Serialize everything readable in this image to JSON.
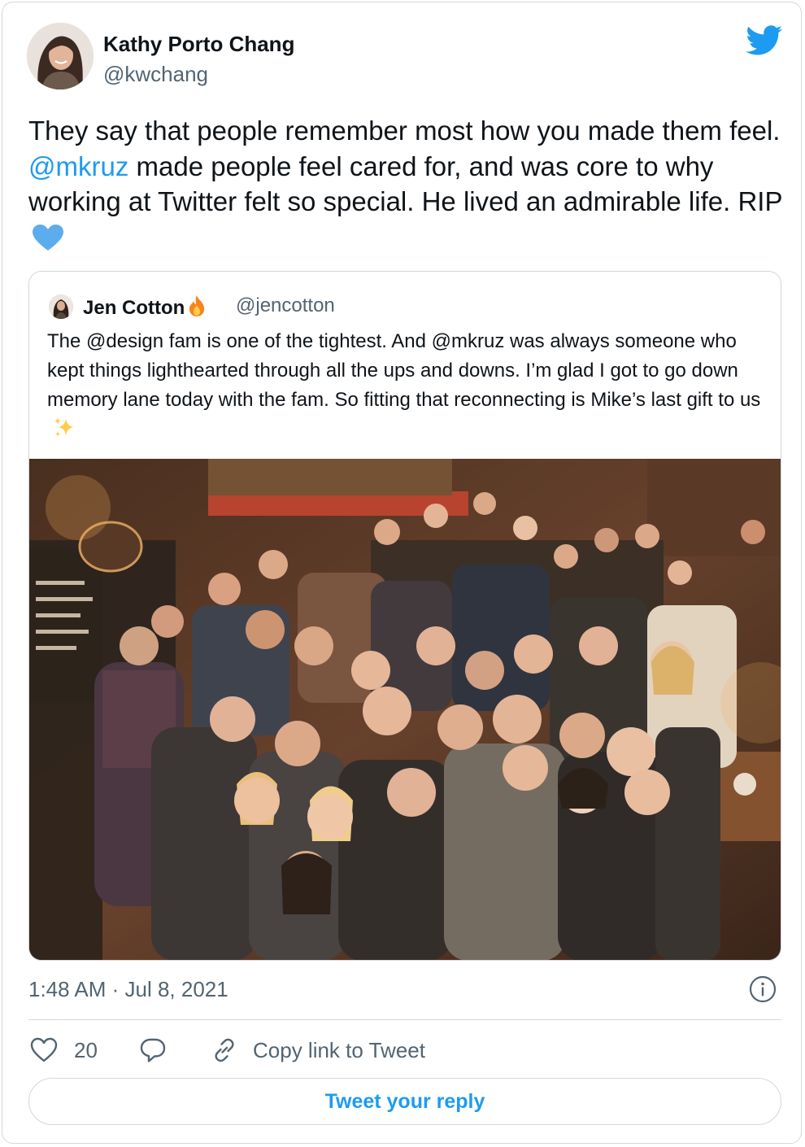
{
  "author": {
    "name": "Kathy Porto Chang",
    "handle": "@kwchang",
    "avatar_icon": "avatar-photo"
  },
  "logo_icon": "twitter-bird-icon",
  "tweet": {
    "text_part1": "They say that people remember most how you made them feel.",
    "mention": "@mkruz",
    "text_part2": "made people feel cared for, and was core to why working at Twitter felt so special. He lived an admirable life. RIP",
    "emoji": "blue-heart"
  },
  "quoted_tweet": {
    "name": "Jen Cotton",
    "name_emoji": "fire",
    "handle": "@jencotton",
    "text": "The @design fam is one of the tightest. And @mkruz was always someone who kept things lighthearted through all the ups and downs. I’m glad I got to go down memory lane today with the fam. So fitting that reconnecting is Mike’s last gift to us",
    "text_emoji": "sparkles",
    "photo_icon": "group-photo"
  },
  "meta": {
    "timestamp": "1:48 AM · Jul 8, 2021",
    "info_icon": "info-icon"
  },
  "actions": {
    "like_count": "20",
    "copy_link_label": "Copy link to Tweet"
  },
  "reply_button": "Tweet your reply",
  "colors": {
    "accent": "#1d9bf0",
    "text": "#0f1419",
    "secondary": "#536471",
    "border": "#cfd9de"
  }
}
